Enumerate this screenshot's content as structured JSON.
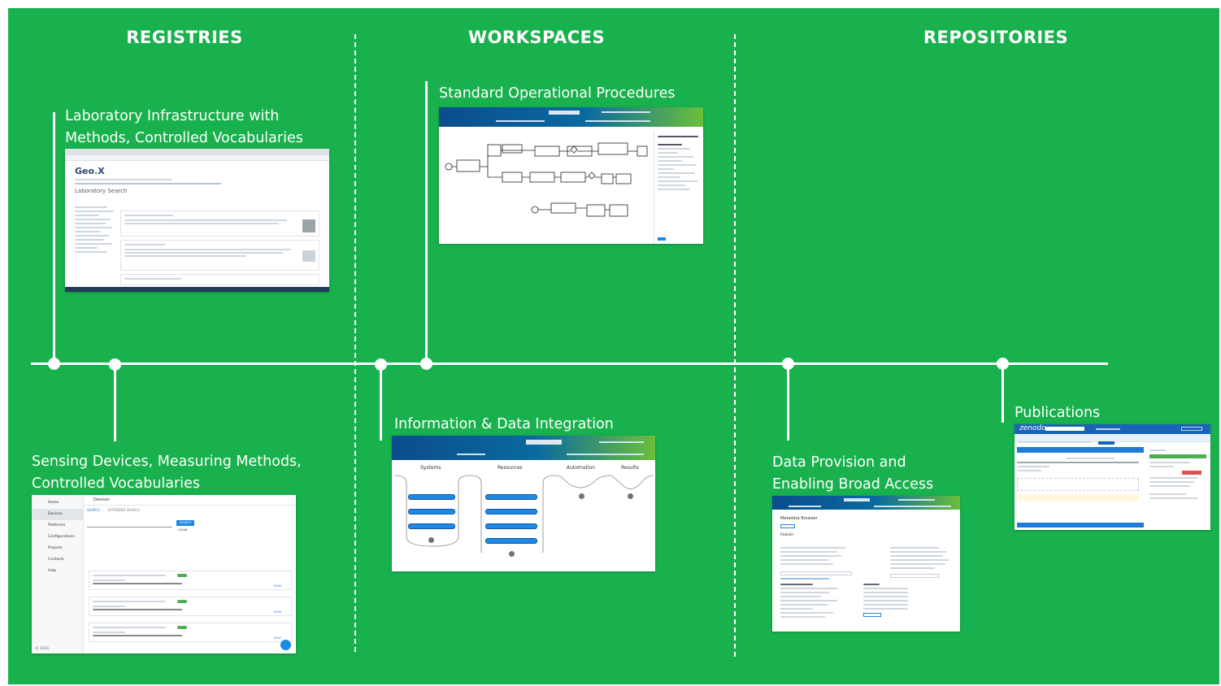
{
  "columns": {
    "registries": "REGISTRIES",
    "workspaces": "WORKSPACES",
    "repositories": "REPOSITORIES"
  },
  "milestones": {
    "lab_infrastructure": {
      "line1": "Laboratory Infrastructure with",
      "line2": "Methods, Controlled Vocabularies"
    },
    "sensing_devices": {
      "line1": "Sensing Devices, Measuring Methods,",
      "line2": "Controlled Vocabularies"
    },
    "sop": {
      "line1": "Standard Operational Procedures"
    },
    "info_integration": {
      "line1": "Information & Data Integration"
    },
    "data_provision": {
      "line1": "Data Provision and",
      "line2": "Enabling Broad Access"
    },
    "publications": {
      "line1": "Publications"
    }
  },
  "screenshots": {
    "geox": {
      "logo": "Geo",
      "logo_mark": "X",
      "page_title": "Laboratory Search"
    },
    "devices": {
      "sidebar": [
        "Home",
        "Devices",
        "Platforms",
        "Configurations",
        "Projects",
        "Contacts",
        "Help"
      ],
      "header": "Devices",
      "tabs": [
        "SEARCH",
        "EXTENDED SEARCH"
      ],
      "search_button": "SEARCH",
      "clear_button": "CLEAR",
      "view_label": "VIEW",
      "footer": "© 2021"
    },
    "integration": {
      "columns": [
        "Systems",
        "Resources",
        "Automation",
        "Results"
      ]
    },
    "zenodo": {
      "logo": "zenodo"
    },
    "data_provision": {
      "title": "Metadata Browser",
      "section": "Publish"
    }
  },
  "colors": {
    "background": "#18b14d",
    "foreground": "#ffffff",
    "screenshot_header": "#0a4d8c",
    "zenodo_blue": "#1a63b8"
  }
}
